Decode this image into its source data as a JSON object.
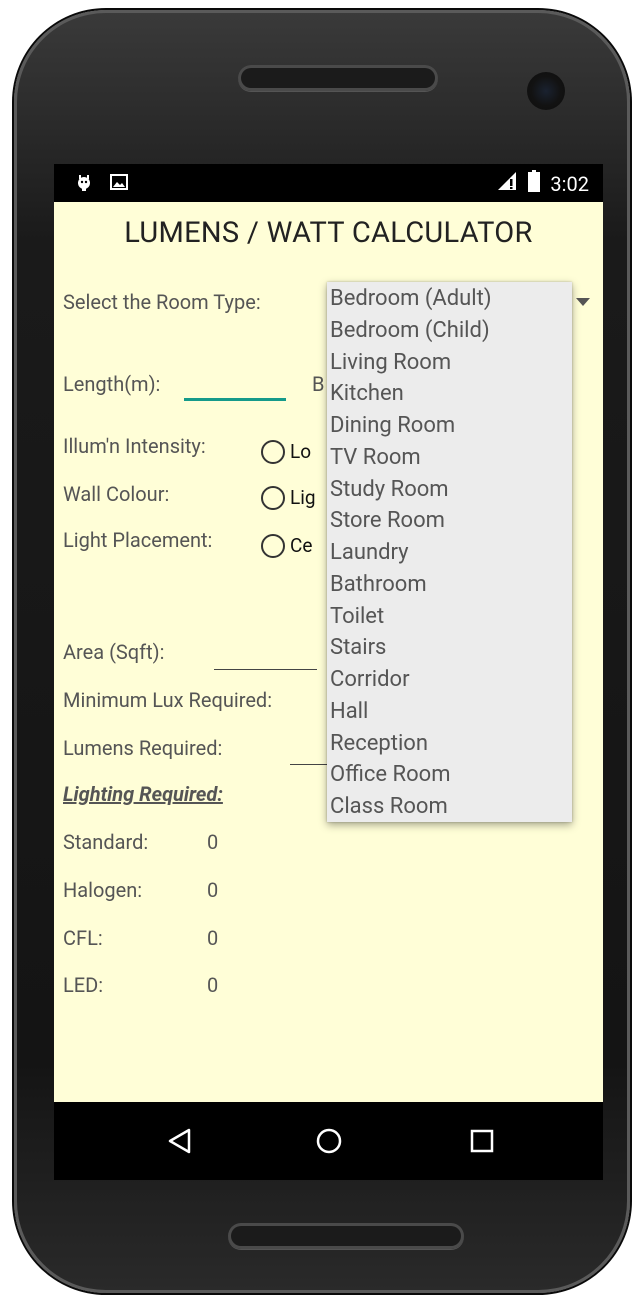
{
  "status_bar": {
    "left_icons": [
      "android-debug-icon",
      "image-icon"
    ],
    "right_icons": [
      "signal-icon",
      "battery-icon"
    ],
    "time": "3:02"
  },
  "app": {
    "title": "LUMENS / WATT CALCULATOR",
    "room_type_label": "Select the Room Type:",
    "length_label": "Length(m):",
    "breadth_label_partial": "B",
    "illum_label": "Illum'n Intensity:",
    "illum_option_partial": "Lo",
    "wall_label": "Wall Colour:",
    "wall_option_partial": "Lig",
    "placement_label": "Light Placement:",
    "placement_option_partial": "Ce",
    "area_label": "Area (Sqft):",
    "min_lux_label": "Minimum Lux Required:",
    "lumens_label": "Lumens Required:",
    "lighting_required_label": "Lighting Required:",
    "results": [
      {
        "label": "Standard:",
        "value": "0"
      },
      {
        "label": "Halogen:",
        "value": "0"
      },
      {
        "label": "CFL:",
        "value": "0"
      },
      {
        "label": "LED:",
        "value": "0"
      }
    ],
    "accent_color": "#159a8a",
    "background_color": "#fffed7"
  },
  "dropdown": {
    "options": [
      "Bedroom (Adult)",
      "Bedroom (Child)",
      "Living Room",
      "Kitchen",
      "Dining Room",
      "TV Room",
      "Study Room",
      "Store Room",
      "Laundry",
      "Bathroom",
      "Toilet",
      "Stairs",
      "Corridor",
      "Hall",
      "Reception",
      "Office Room",
      "Class Room"
    ]
  },
  "nav_bar": {
    "buttons": [
      "back-icon",
      "home-icon",
      "recents-icon"
    ]
  }
}
